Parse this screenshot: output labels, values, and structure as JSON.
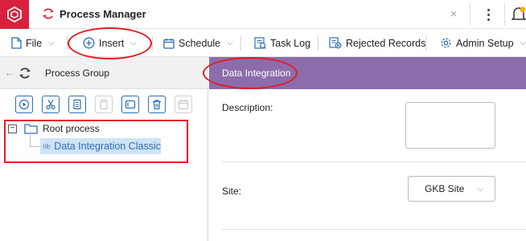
{
  "titlebar": {
    "title": "Process Manager",
    "close_glyph": "×",
    "icons": [
      "app-logo-icon",
      "process-manager-icon",
      "more-vertical-icon",
      "bell-icon"
    ]
  },
  "menu": {
    "items": [
      {
        "label": "File",
        "icon": "file-icon",
        "has_dropdown": true
      },
      {
        "label": "Insert",
        "icon": "plus-circle-icon",
        "has_dropdown": true
      },
      {
        "label": "Schedule",
        "icon": "calendar-icon",
        "has_dropdown": true
      },
      {
        "label": "Task Log",
        "icon": "task-log-icon",
        "has_dropdown": false
      },
      {
        "label": "Rejected Records",
        "icon": "rejected-records-icon",
        "has_dropdown": false
      },
      {
        "label": "Admin Setup",
        "icon": "gear-icon",
        "has_dropdown": true
      }
    ]
  },
  "left_panel": {
    "back_glyph": "←",
    "title": "Process Group",
    "toolbar": [
      "run-icon",
      "cut-icon",
      "copy-icon",
      "paste-icon",
      "rename-icon",
      "delete-icon",
      "schedule-icon"
    ],
    "tree": {
      "expander": "−",
      "root_label": "Root process",
      "child_label": "Data Integration Classic"
    }
  },
  "right_panel": {
    "title": "Data Integration",
    "description_label": "Description:",
    "site_label": "Site:",
    "site_value": "GKB Site",
    "select_chev": "⌵"
  },
  "colors": {
    "brand_red": "#d8213d",
    "header_purple": "#8d6cab",
    "accent_blue": "#2f6fb0",
    "selection_blue": "#cfe3f6",
    "annotation_red": "#e31b23"
  }
}
